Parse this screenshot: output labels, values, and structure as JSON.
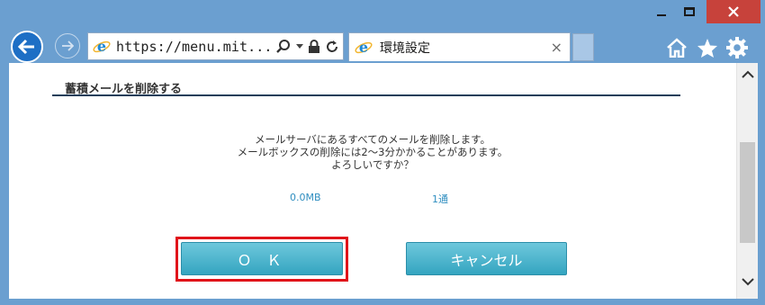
{
  "address_bar": {
    "url": "https://menu.mit..."
  },
  "tab": {
    "title": "環境設定",
    "close_glyph": "×"
  },
  "page": {
    "section_title": "蓄積メールを削除する",
    "message_lines": [
      "メールサーバにあるすべてのメールを削除します。",
      "メールボックスの削除には2～3分かかることがあります。",
      "よろしいですか？"
    ],
    "mailbox_size": "0.0MB",
    "mail_count": "1通",
    "ok_label": "Ｏ Ｋ",
    "cancel_label": "キャンセル"
  },
  "colors": {
    "accent": "#2f8ec0",
    "highlight_frame": "#e0141a",
    "button_top": "#6ec8dc",
    "button_bottom": "#34a5c0"
  }
}
